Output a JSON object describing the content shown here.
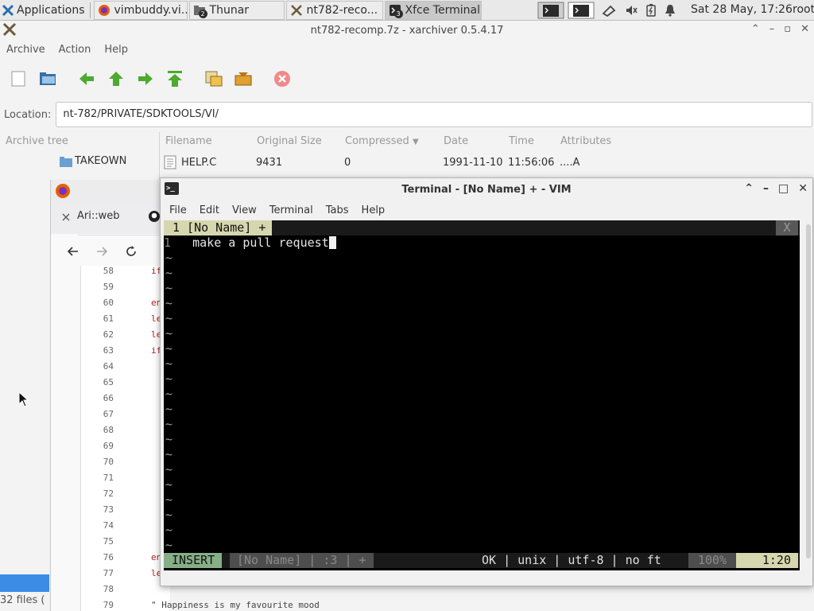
{
  "panel": {
    "applications_label": "Applications",
    "tasks": [
      {
        "label": "vimbuddy.vi...",
        "icon": "firefox-icon"
      },
      {
        "label": "Thunar",
        "icon": "folder-icon",
        "badge": "2"
      },
      {
        "label": "nt782-reco...",
        "icon": "xarchiver-icon"
      },
      {
        "label": "Xfce Terminal",
        "icon": "terminal-icon",
        "badge": "3"
      }
    ],
    "clock": "Sat 28 May, 17:26",
    "user": "root"
  },
  "xarchiver": {
    "title": "nt782-recomp.7z - xarchiver 0.5.4.17",
    "menu": [
      "Archive",
      "Action",
      "Help"
    ],
    "location_label": "Location:",
    "location_value": "nt-782/PRIVATE/SDKTOOLS/VI/",
    "tree_header": "Archive tree",
    "tree_items": [
      "TAKEOWN"
    ],
    "columns": [
      "Filename",
      "Original Size",
      "Compressed",
      "Date",
      "Time",
      "Attributes"
    ],
    "rows": [
      {
        "filename": "HELP.C",
        "original_size": "9431",
        "compressed": "0",
        "date": "1991-11-10",
        "time": "11:56:06",
        "attributes": "....A"
      }
    ],
    "status": "32 files ("
  },
  "firefox": {
    "tab_label": "Ari::web",
    "line_numbers": [
      "58",
      "59",
      "60",
      "61",
      "62",
      "63",
      "64",
      "65",
      "66",
      "67",
      "68",
      "69",
      "70",
      "71",
      "72",
      "73",
      "74",
      "75",
      "76",
      "77",
      "78",
      "79"
    ],
    "keywords": [
      {
        "line": "58",
        "text": "if"
      },
      {
        "line": "60",
        "text": "en"
      },
      {
        "line": "61",
        "text": "le"
      },
      {
        "line": "62",
        "text": "le"
      },
      {
        "line": "63",
        "text": "if"
      },
      {
        "line": "76",
        "text": "en"
      },
      {
        "line": "77",
        "text": "le"
      }
    ],
    "comment_line": "\" Happiness is my favourite mood"
  },
  "terminal": {
    "title": "Terminal - [No Name] + - VIM",
    "menu": [
      "File",
      "Edit",
      "View",
      "Terminal",
      "Tabs",
      "Help"
    ],
    "vim": {
      "tab_label": "1 [No Name] +",
      "tab_close": "X",
      "line_number": "1",
      "line_text": "make a pull request",
      "tilde": "~",
      "mode": "INSERT",
      "file_segment": "[No Name] | :3 | +",
      "info": "OK | unix | utf-8 | no ft",
      "percent": "100%",
      "position": "1:20"
    }
  }
}
